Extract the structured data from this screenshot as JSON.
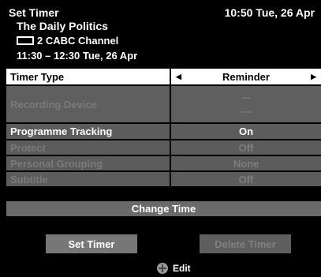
{
  "header": {
    "title": "Set Timer",
    "clock": "10:50 Tue, 26 Apr",
    "programme": "The Daily Politics",
    "channel": "2 CABC Channel",
    "time_range": "11:30 – 12:30 Tue, 26 Apr"
  },
  "settings": {
    "timer_type": {
      "label": "Timer Type",
      "value": "Reminder"
    },
    "recording_device": {
      "label": "Recording Device",
      "value_line1": "—",
      "value_line2": "—"
    },
    "programme_tracking": {
      "label": "Programme Tracking",
      "value": "On"
    },
    "protect": {
      "label": "Protect",
      "value": "Off"
    },
    "personal_grouping": {
      "label": "Personal Grouping",
      "value": "None"
    },
    "subtitle": {
      "label": "Subtitle",
      "value": "Off"
    }
  },
  "actions": {
    "change_time": "Change Time",
    "set_timer": "Set Timer",
    "delete_timer": "Delete Timer"
  },
  "hint": {
    "icon": "dpad-icon",
    "label": "Edit"
  }
}
